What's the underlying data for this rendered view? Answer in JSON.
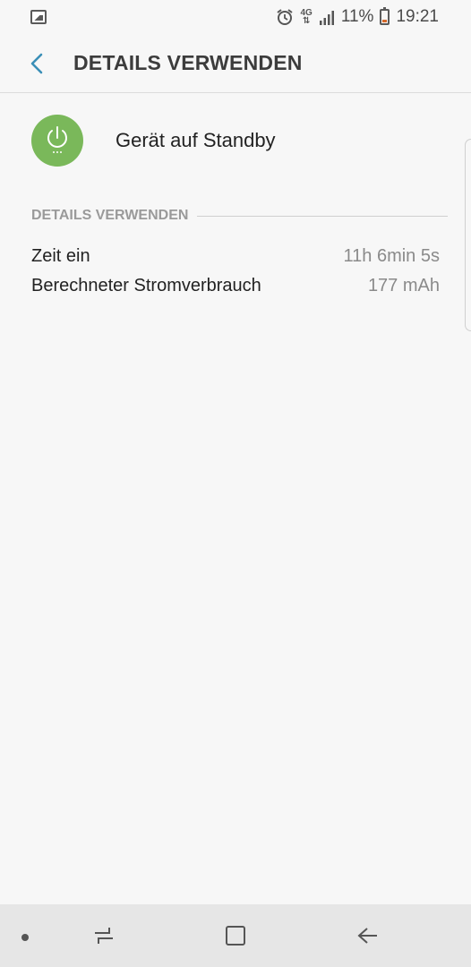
{
  "status_bar": {
    "network": "4G",
    "battery_percent": "11%",
    "time": "19:21",
    "icons": [
      "image-icon",
      "alarm-icon",
      "signal-icon",
      "battery-icon"
    ]
  },
  "header": {
    "title": "DETAILS VERWENDEN",
    "back_icon": "back-arrow-icon",
    "accent_color": "#3a8fb7"
  },
  "app": {
    "name": "Gerät auf Standby",
    "icon": "power-icon",
    "icon_color": "#7ab85a"
  },
  "section": {
    "title": "DETAILS VERWENDEN",
    "rows": [
      {
        "label": "Zeit ein",
        "value": "11h 6min 5s"
      },
      {
        "label": "Berechneter Stromverbrauch",
        "value": "177 mAh"
      }
    ]
  },
  "nav_bar": {
    "buttons": [
      "recents-icon",
      "home-icon",
      "back-icon"
    ]
  }
}
